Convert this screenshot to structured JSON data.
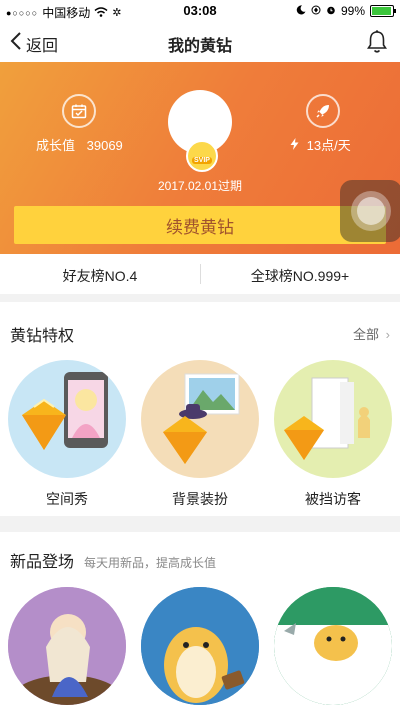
{
  "status_bar": {
    "signal_dots": "●○○○○",
    "carrier": "中国移动",
    "time": "03:08",
    "battery": "99%",
    "battery_level": 0.99
  },
  "nav": {
    "back_label": "返回",
    "title": "我的黄钻"
  },
  "hero": {
    "growth_label": "成长值",
    "growth_value": "39069",
    "speed": "13点/天",
    "vip_badge": "SVIP",
    "expiry": "2017.02.01过期",
    "renew_label": "续费黄钻"
  },
  "ranks": {
    "friends": "好友榜NO.4",
    "global": "全球榜NO.999+"
  },
  "privileges": {
    "title": "黄钻特权",
    "more": "全部",
    "items": [
      {
        "label": "空间秀"
      },
      {
        "label": "背景装扮"
      },
      {
        "label": "被挡访客"
      }
    ]
  },
  "new_products": {
    "title": "新品登场",
    "subtitle": "每天用新品，提高成长值"
  },
  "colors": {
    "hero_start": "#f0a03c",
    "hero_end": "#ec6b36",
    "renew_button": "#ffd23d",
    "renew_text": "#a0522d"
  }
}
